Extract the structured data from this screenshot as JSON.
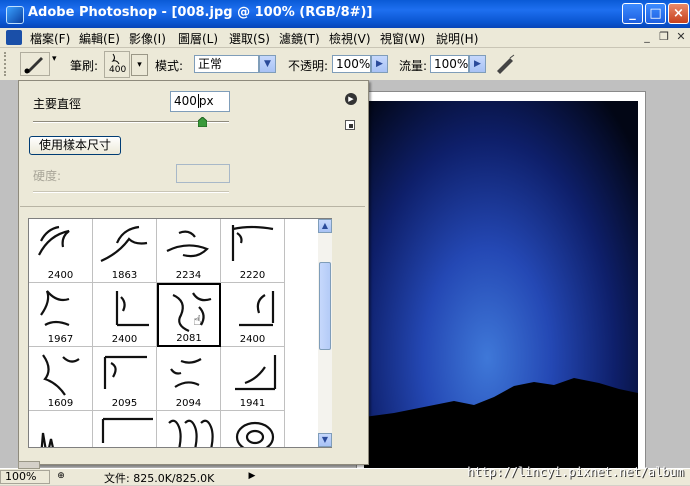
{
  "window": {
    "title": "Adobe Photoshop - [008.jpg @ 100% (RGB/8#)]",
    "min_glyph": "_",
    "max_glyph": "□",
    "close_glyph": "×"
  },
  "menu": [
    {
      "label": "檔案(F)"
    },
    {
      "label": "編輯(E)"
    },
    {
      "label": "影像(I)"
    },
    {
      "label": "圖層(L)"
    },
    {
      "label": "選取(S)"
    },
    {
      "label": "濾鏡(T)"
    },
    {
      "label": "檢視(V)"
    },
    {
      "label": "視窗(W)"
    },
    {
      "label": "說明(H)"
    }
  ],
  "options": {
    "brush_label": "筆刷:",
    "brush_size": "400",
    "mode_label": "模式:",
    "mode_value": "正常",
    "opacity_label": "不透明:",
    "opacity_value": "100%",
    "flow_label": "流量:",
    "flow_value": "100%"
  },
  "brush_panel": {
    "diameter_label": "主要直徑",
    "diameter_value": "400",
    "diameter_unit": "px",
    "diameter_fraction": 0.86,
    "sample_button": "使用樣本尺寸",
    "hardness_label": "硬度:",
    "brushes": [
      {
        "size": "2400",
        "selected": false
      },
      {
        "size": "1863",
        "selected": false
      },
      {
        "size": "2234",
        "selected": false
      },
      {
        "size": "2220",
        "selected": false
      },
      {
        "size": "1967",
        "selected": false
      },
      {
        "size": "2400",
        "selected": false
      },
      {
        "size": "2081",
        "selected": true
      },
      {
        "size": "2400",
        "selected": false
      },
      {
        "size": "1609",
        "selected": false
      },
      {
        "size": "2095",
        "selected": false
      },
      {
        "size": "2094",
        "selected": false
      },
      {
        "size": "1941",
        "selected": false
      },
      {
        "size": "",
        "selected": false
      },
      {
        "size": "",
        "selected": false
      },
      {
        "size": "",
        "selected": false
      },
      {
        "size": "",
        "selected": false
      }
    ]
  },
  "status": {
    "zoom": "100%",
    "doc_info": "文件: 825.0K/825.0K"
  },
  "watermark": "http://lincyi.pixnet.net/album",
  "colors": {
    "title_blue": "#0a5ad6",
    "panel_bg": "#ece9d8",
    "scroll_blue": "#a8c2f5"
  }
}
